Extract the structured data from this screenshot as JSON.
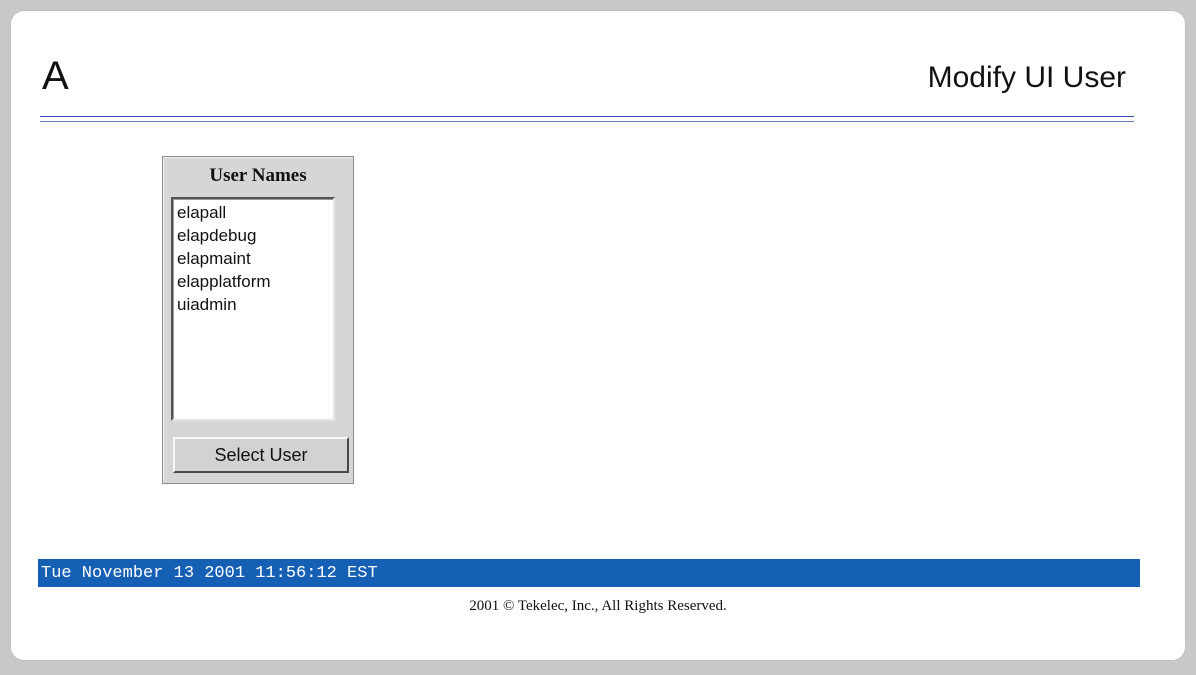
{
  "header": {
    "server_letter": "A",
    "title": "Modify UI User"
  },
  "user_panel": {
    "title": "User Names",
    "users": [
      "elapall",
      "elapdebug",
      "elapmaint",
      "elapplatform",
      "uiadmin"
    ],
    "select_button_label": "Select User"
  },
  "status_bar": {
    "datetime": "Tue November 13 2001 11:56:12 EST"
  },
  "footer": {
    "copyright": "2001 © Tekelec, Inc., All Rights Reserved."
  },
  "colors": {
    "status_bar_bg": "#1560b4",
    "header_rule": "#3a4aa8"
  }
}
